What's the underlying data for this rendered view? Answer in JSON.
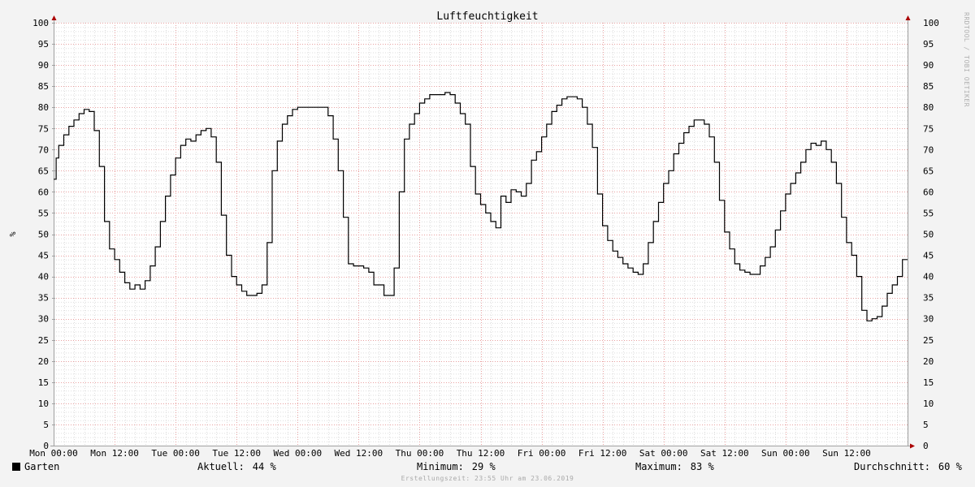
{
  "chart_data": {
    "type": "line",
    "title": "Luftfeuchtigkeit",
    "ylabel": "%",
    "ylim": [
      0,
      100
    ],
    "yticks": [
      0,
      5,
      10,
      15,
      20,
      25,
      30,
      35,
      40,
      45,
      50,
      55,
      60,
      65,
      70,
      75,
      80,
      85,
      90,
      95,
      100
    ],
    "xlim_hours": [
      0,
      168
    ],
    "xtick_labels": [
      "Mon 00:00",
      "Mon 12:00",
      "Tue 00:00",
      "Tue 12:00",
      "Wed 00:00",
      "Wed 12:00",
      "Thu 00:00",
      "Thu 12:00",
      "Fri 00:00",
      "Fri 12:00",
      "Sat 00:00",
      "Sat 12:00",
      "Sun 00:00",
      "Sun 12:00"
    ],
    "grid": true,
    "series": [
      {
        "name": "Garten",
        "color": "#000000",
        "step": true,
        "x_hours": [
          0,
          0.5,
          1,
          2,
          3,
          4,
          5,
          6,
          7,
          8,
          9,
          10,
          11,
          12,
          13,
          14,
          15,
          16,
          17,
          18,
          19,
          20,
          21,
          22,
          23,
          24,
          25,
          26,
          27,
          28,
          29,
          30,
          31,
          32,
          33,
          34,
          35,
          36,
          37,
          38,
          39,
          40,
          41,
          42,
          43,
          44,
          45,
          46,
          47,
          48,
          49,
          50,
          51,
          52,
          53,
          54,
          55,
          56,
          57,
          58,
          59,
          60,
          61,
          62,
          63,
          64,
          65,
          66,
          67,
          68,
          69,
          70,
          71,
          72,
          73,
          74,
          75,
          76,
          77,
          78,
          79,
          80,
          81,
          82,
          83,
          84,
          85,
          86,
          87,
          88,
          89,
          90,
          91,
          92,
          93,
          94,
          95,
          96,
          97,
          98,
          99,
          100,
          101,
          102,
          103,
          104,
          105,
          106,
          107,
          108,
          109,
          110,
          111,
          112,
          113,
          114,
          115,
          116,
          117,
          118,
          119,
          120,
          121,
          122,
          123,
          124,
          125,
          126,
          127,
          128,
          129,
          130,
          131,
          132,
          133,
          134,
          135,
          136,
          137,
          138,
          139,
          140,
          141,
          142,
          143,
          144,
          145,
          146,
          147,
          148,
          149,
          150,
          151,
          152,
          153,
          154,
          155,
          156,
          157,
          158,
          159,
          160,
          161,
          162,
          163,
          164,
          165,
          166,
          167,
          168
        ],
        "values": [
          63,
          68,
          71,
          73.5,
          75.5,
          77,
          78.5,
          79.5,
          79,
          74.5,
          66,
          53,
          46.5,
          44,
          41,
          38.5,
          37,
          38,
          37,
          39,
          42.5,
          47,
          53,
          59,
          64,
          68,
          71,
          72.5,
          72,
          73.5,
          74.5,
          75,
          73,
          67,
          54.5,
          45,
          40,
          38,
          36.5,
          35.5,
          35.5,
          36,
          38,
          48,
          65,
          72,
          76,
          78,
          79.5,
          80,
          80,
          80,
          80,
          80,
          80,
          78,
          72.5,
          65,
          54,
          43,
          42.5,
          42.5,
          42,
          41,
          38,
          38,
          35.5,
          35.5,
          42,
          60,
          72.5,
          76,
          78.5,
          81,
          82,
          83,
          83,
          83,
          83.5,
          83,
          81,
          78.5,
          76,
          66,
          59.5,
          57,
          55,
          53,
          51.5,
          59,
          57.5,
          60.5,
          60,
          59,
          62,
          67.5,
          69.5,
          73,
          76,
          79,
          80.5,
          82,
          82.5,
          82.5,
          82,
          80,
          76,
          70.5,
          59.5,
          52,
          48.5,
          46,
          44.5,
          43,
          42,
          41,
          40.5,
          43,
          48,
          53,
          57.5,
          62,
          65,
          69,
          71.5,
          74,
          75.5,
          77,
          77,
          76,
          73,
          67,
          58,
          50.5,
          46.5,
          43,
          41.5,
          41,
          40.5,
          40.5,
          42.5,
          44.5,
          47,
          51,
          55.5,
          59.5,
          62,
          64.5,
          67,
          70,
          71.5,
          71,
          72,
          70,
          67,
          62,
          54,
          48,
          45,
          40,
          32,
          29.5,
          30,
          30.5,
          33,
          36,
          38,
          40,
          44,
          44
        ]
      }
    ]
  },
  "page": {
    "title": "Luftfeuchtigkeit",
    "y_unit": "%",
    "legend_name": "Garten",
    "stats": {
      "current_label": "Aktuell:",
      "current_value": "44 %",
      "min_label": "Minimum:",
      "min_value": "29 %",
      "max_label": "Maximum:",
      "max_value": "83 %",
      "avg_label": "Durchschnitt:",
      "avg_value": "60 %"
    },
    "footer": "Erstellungszeit: 23:55 Uhr am 23.06.2019",
    "credit": "RRDTOOL / TOBI OETIKER"
  },
  "colors": {
    "background": "#f3f3f3",
    "plot_background": "#ffffff",
    "major_grid": "#e8a0a0",
    "minor_grid": "#dddddd",
    "axis": "#a0a0a0",
    "arrow": "#aa0000",
    "line": "#000000"
  }
}
